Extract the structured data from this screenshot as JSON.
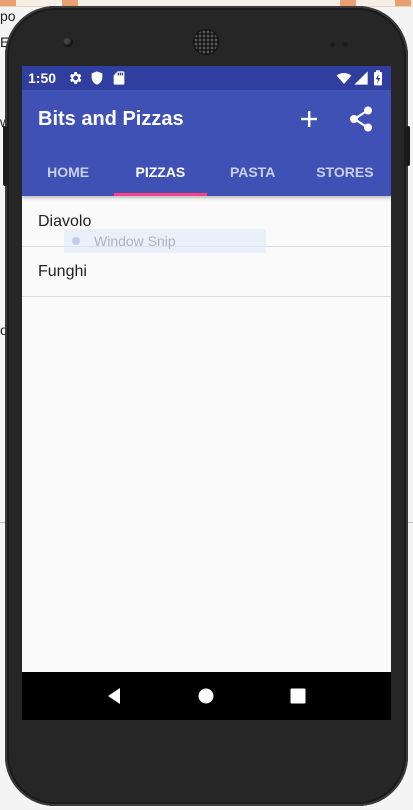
{
  "desktop": {
    "fragments": [
      "po",
      "E",
      "w",
      "o",
      ")"
    ]
  },
  "status_bar": {
    "time": "1:50",
    "icons": [
      "gear-icon",
      "shield-icon",
      "sd-card-icon",
      "wifi-icon",
      "cell-signal-icon",
      "battery-charging-icon"
    ]
  },
  "app_bar": {
    "title": "Bits and Pizzas",
    "actions": [
      "add-icon",
      "share-icon"
    ]
  },
  "tabs": [
    {
      "label": "HOME",
      "active": false
    },
    {
      "label": "PIZZAS",
      "active": true
    },
    {
      "label": "PASTA",
      "active": false
    },
    {
      "label": "STORES",
      "active": false
    }
  ],
  "pizzas": [
    "Diavolo",
    "Funghi"
  ],
  "overlay": {
    "label": "Window Snip"
  },
  "navigation": [
    "back-icon",
    "home-icon",
    "recents-icon"
  ],
  "colors": {
    "primary": "#3f51b5",
    "primary_dark": "#303f9f",
    "accent": "#ff4081",
    "background": "#fafafa"
  }
}
